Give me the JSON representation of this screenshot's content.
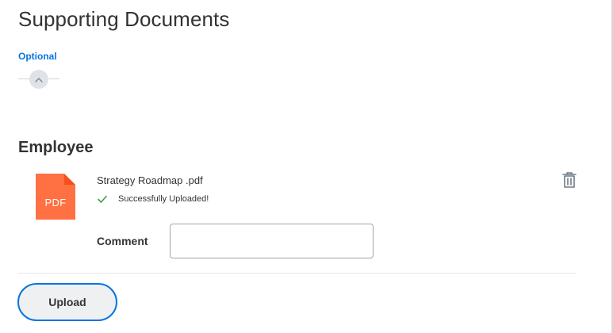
{
  "header": {
    "title": "Supporting Documents",
    "optional_label": "Optional"
  },
  "collapse": {
    "icon": "chevron-up-icon"
  },
  "employee": {
    "title": "Employee",
    "attachment": {
      "file_icon_label": "PDF",
      "file_icon_color": "#ff7043",
      "file_name": "Strategy Roadmap .pdf",
      "status": "Successfully Uploaded!",
      "status_color": "#43a047",
      "delete_icon": "trash-icon"
    },
    "comment": {
      "label": "Comment",
      "value": "",
      "placeholder": ""
    }
  },
  "actions": {
    "upload_label": "Upload"
  },
  "colors": {
    "accent": "#0875e1",
    "text": "#333333"
  }
}
